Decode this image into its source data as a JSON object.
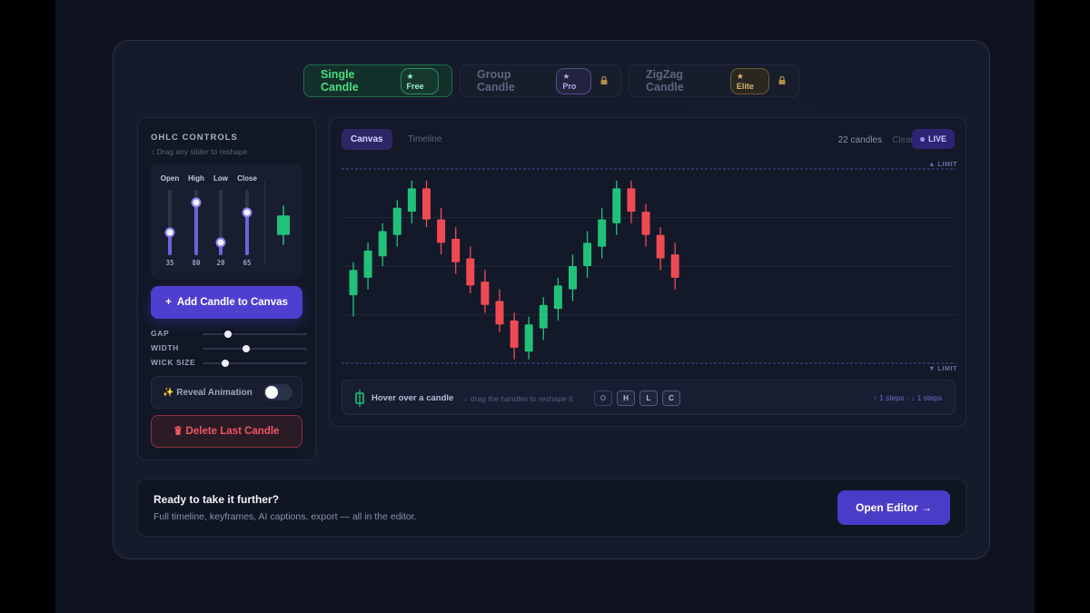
{
  "tabs": [
    {
      "label": "Single Candle",
      "badge": "★ Free",
      "locked": false
    },
    {
      "label": "Group Candle",
      "badge": "★ Pro",
      "locked": true
    },
    {
      "label": "ZigZag Candle",
      "badge": "★ Elite",
      "locked": true
    }
  ],
  "icons": {
    "lock": "lock-icon",
    "sparkle": "sparkles-icon",
    "trash": "trash-icon",
    "candle": "candle-icon"
  },
  "controls": {
    "title": "OHLC CONTROLS",
    "hint": "↕ Drag any slider to reshape",
    "sliders": [
      {
        "label": "Open",
        "value": 35
      },
      {
        "label": "High",
        "value": 80
      },
      {
        "label": "Low",
        "value": 20
      },
      {
        "label": "Close",
        "value": 65
      }
    ],
    "add_button": "Add Candle to Canvas",
    "add_icon": "+",
    "ranges": [
      {
        "label": "GAP",
        "value": 0.24
      },
      {
        "label": "WIDTH",
        "value": 0.42
      },
      {
        "label": "WICK SIZE",
        "value": 0.22
      }
    ],
    "reveal_label": "✨ Reveal Animation",
    "reveal_on": false,
    "delete_button": "Delete Last Candle"
  },
  "chart": {
    "view_tabs": [
      "Canvas",
      "Timeline"
    ],
    "count_label": "22 candles",
    "clear_label": "Clear",
    "live_label": "LIVE",
    "upper_limit_label": "▲ LIMIT",
    "lower_limit_label": "▼ LIMIT",
    "colors": {
      "up": "#22c17a",
      "down": "#ef4a54",
      "limit": "#4c4796"
    },
    "hover_title": "Hover over a candle",
    "hover_hint": "→ drag the handles to reshape it",
    "keys": [
      "O",
      "H",
      "L",
      "C"
    ],
    "steps_label": "↑ 1 steps · ↓ 1 steps"
  },
  "chart_data": {
    "type": "candlestick",
    "ylim": [
      0,
      100
    ],
    "candles": [
      {
        "o": 35,
        "h": 52,
        "l": 24,
        "c": 48
      },
      {
        "o": 44,
        "h": 62,
        "l": 38,
        "c": 58
      },
      {
        "o": 55,
        "h": 72,
        "l": 50,
        "c": 68
      },
      {
        "o": 66,
        "h": 84,
        "l": 60,
        "c": 80
      },
      {
        "o": 78,
        "h": 94,
        "l": 72,
        "c": 90
      },
      {
        "o": 90,
        "h": 94,
        "l": 70,
        "c": 74
      },
      {
        "o": 74,
        "h": 80,
        "l": 56,
        "c": 62
      },
      {
        "o": 64,
        "h": 70,
        "l": 46,
        "c": 52
      },
      {
        "o": 54,
        "h": 60,
        "l": 36,
        "c": 40
      },
      {
        "o": 42,
        "h": 48,
        "l": 26,
        "c": 30
      },
      {
        "o": 32,
        "h": 38,
        "l": 16,
        "c": 20
      },
      {
        "o": 22,
        "h": 26,
        "l": 2,
        "c": 8
      },
      {
        "o": 6,
        "h": 24,
        "l": 2,
        "c": 20
      },
      {
        "o": 18,
        "h": 34,
        "l": 12,
        "c": 30
      },
      {
        "o": 28,
        "h": 44,
        "l": 22,
        "c": 40
      },
      {
        "o": 38,
        "h": 56,
        "l": 32,
        "c": 50
      },
      {
        "o": 50,
        "h": 68,
        "l": 44,
        "c": 62
      },
      {
        "o": 60,
        "h": 80,
        "l": 54,
        "c": 74
      },
      {
        "o": 72,
        "h": 94,
        "l": 66,
        "c": 90
      },
      {
        "o": 90,
        "h": 94,
        "l": 72,
        "c": 78
      },
      {
        "o": 78,
        "h": 82,
        "l": 60,
        "c": 66
      },
      {
        "o": 66,
        "h": 70,
        "l": 48,
        "c": 54
      },
      {
        "o": 56,
        "h": 62,
        "l": 38,
        "c": 44
      }
    ],
    "preview": {
      "o": 35,
      "h": 80,
      "l": 20,
      "c": 65
    }
  },
  "cta": {
    "title": "Ready to take it further?",
    "subtitle": "Full timeline, keyframes, AI captions, export — all in the editor.",
    "button": "Open Editor →"
  }
}
